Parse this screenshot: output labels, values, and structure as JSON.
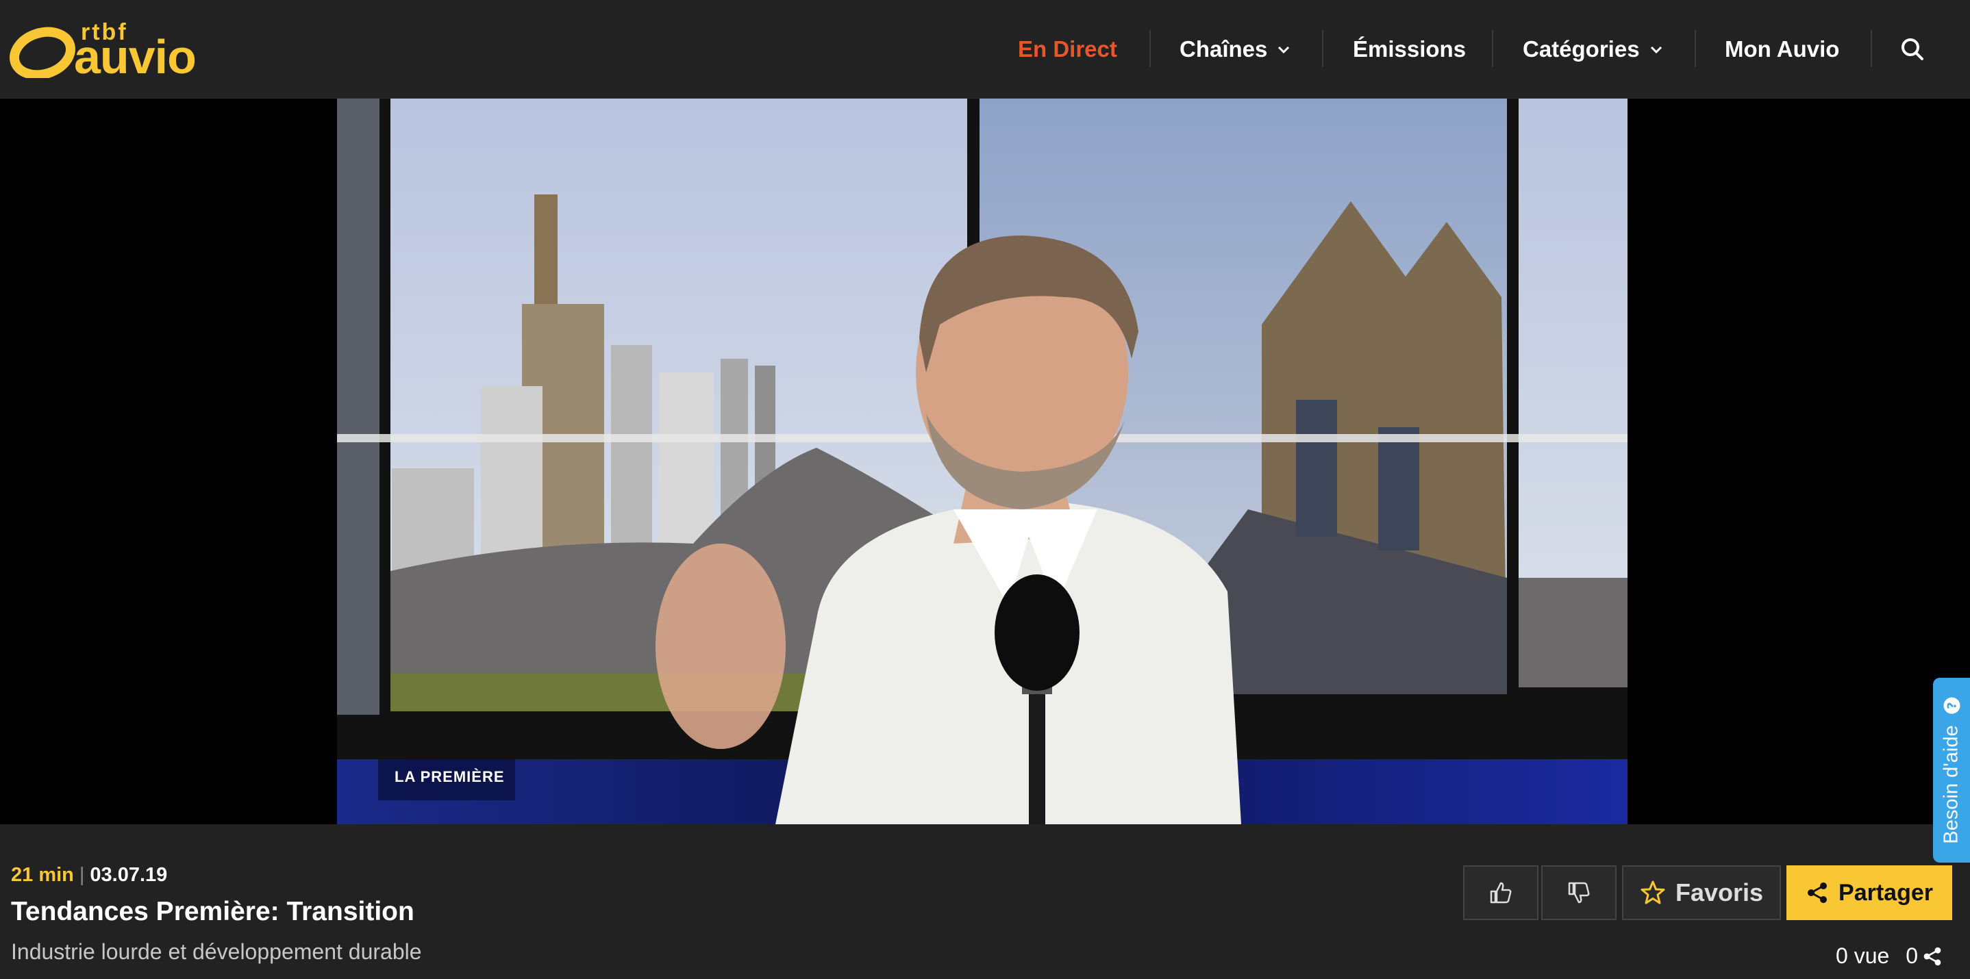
{
  "logo": {
    "small": "rtbf",
    "big": "auvio"
  },
  "nav": {
    "items": [
      {
        "label": "En Direct"
      },
      {
        "label": "Chaînes"
      },
      {
        "label": "Émissions"
      },
      {
        "label": "Catégories"
      },
      {
        "label": "Mon Auvio"
      }
    ]
  },
  "video": {
    "channel_badge": "LA PREMIÈRE"
  },
  "help": {
    "label": "Besoin d'aide"
  },
  "episode": {
    "duration": "21 min",
    "date": "03.07.19",
    "title": "Tendances Première: Transition",
    "subtitle": "Industrie lourde et développement durable"
  },
  "actions": {
    "favoris": "Favoris",
    "partager": "Partager"
  },
  "stats": {
    "views": "0 vue",
    "shares": "0"
  },
  "colors": {
    "accent": "#f9c733",
    "live": "#e8572a",
    "help": "#3aa6e8",
    "background": "#222222"
  }
}
